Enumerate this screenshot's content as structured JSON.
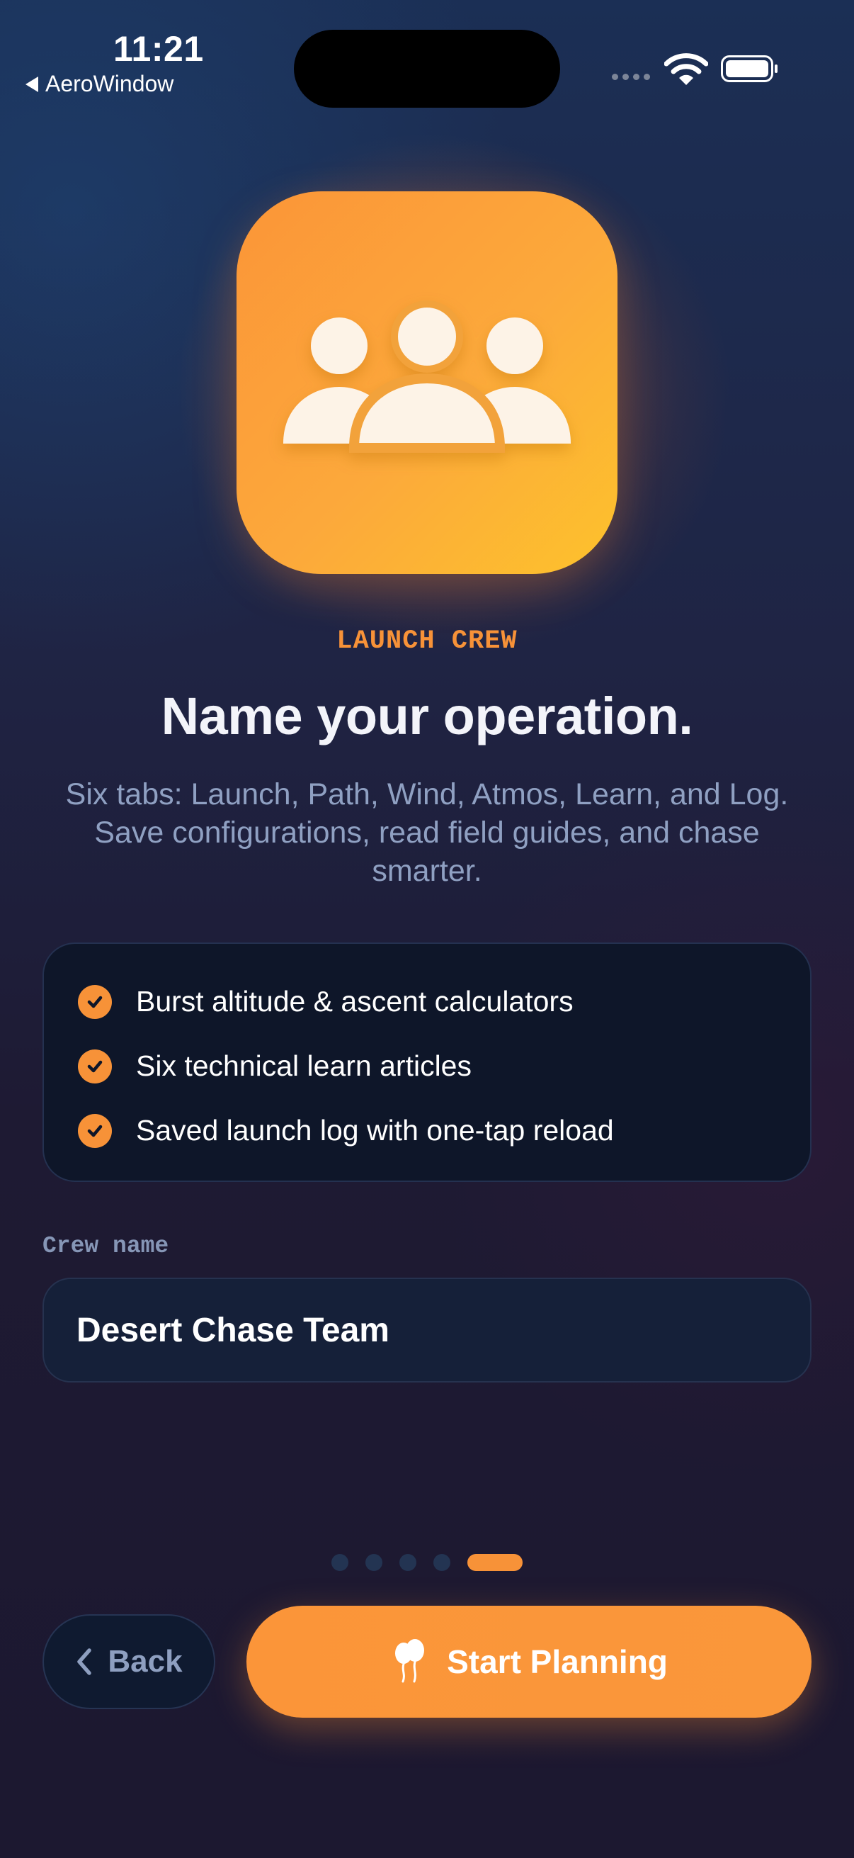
{
  "status_bar": {
    "time": "11:21",
    "back_app": "AeroWindow",
    "icons": [
      "cellular-signal-icon",
      "wifi-icon",
      "battery-icon"
    ]
  },
  "hero": {
    "icon": "people-group-icon",
    "colors": {
      "gradient_start": "#fb9538",
      "gradient_end": "#fdc22c"
    }
  },
  "eyebrow": "LAUNCH CREW",
  "title": "Name your operation.",
  "subtitle": "Six tabs: Launch, Path, Wind, Atmos, Learn, and Log. Save configurations, read field guides, and chase smarter.",
  "features": [
    {
      "icon": "checkmark-circle-icon",
      "text": "Burst altitude & ascent calculators"
    },
    {
      "icon": "checkmark-circle-icon",
      "text": "Six technical learn articles"
    },
    {
      "icon": "checkmark-circle-icon",
      "text": "Saved launch log with one-tap reload"
    }
  ],
  "crew_field": {
    "label": "Crew name",
    "value": "Desert Chase Team"
  },
  "pagination": {
    "total": 5,
    "current": 5
  },
  "buttons": {
    "back": {
      "label": "Back",
      "icon": "chevron-left-icon"
    },
    "start": {
      "label": "Start Planning",
      "icon": "balloons-icon"
    }
  },
  "colors": {
    "accent": "#f79238",
    "card_bg": "#0e1629",
    "muted_text": "#8fa0c2"
  }
}
